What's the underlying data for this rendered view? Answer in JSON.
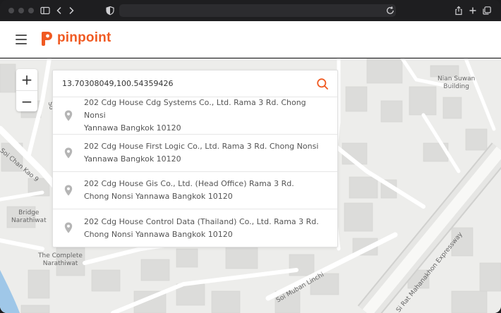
{
  "app": {
    "brand": "pinpoint",
    "brand_color": "#f05a22"
  },
  "map": {
    "labels": {
      "nian_suwan": "Nian Suwan\nBuilding",
      "soi_chan_kao": "Soi Chan Kao 9",
      "bridge_narathiwat": "Bridge\nNarathiwat",
      "complete_narathiwat": "The Complete\nNarathiwat",
      "soi_muban_linchi": "Soi Muban Linchi",
      "expressway": "Si Rat Mahanakhon Expressway",
      "partial_so": "So"
    },
    "zoom_in": "+",
    "zoom_out": "−"
  },
  "search": {
    "value": "13.70308049,100.54359426",
    "results": [
      {
        "line1": "202 Cdg House Cdg Systems Co., Ltd. Rama 3 Rd. Chong Nonsi",
        "line2": "Yannawa Bangkok 10120"
      },
      {
        "line1": "202 Cdg House First Logic Co., Ltd. Rama 3 Rd. Chong Nonsi",
        "line2": "Yannawa Bangkok 10120"
      },
      {
        "line1": "202 Cdg House Gis Co., Ltd. (Head Office) Rama 3 Rd.",
        "line2": "Chong Nonsi Yannawa Bangkok 10120"
      },
      {
        "line1": "202 Cdg House Control Data (Thailand) Co., Ltd. Rama 3 Rd.",
        "line2": "Chong Nonsi Yannawa Bangkok 10120"
      }
    ]
  }
}
